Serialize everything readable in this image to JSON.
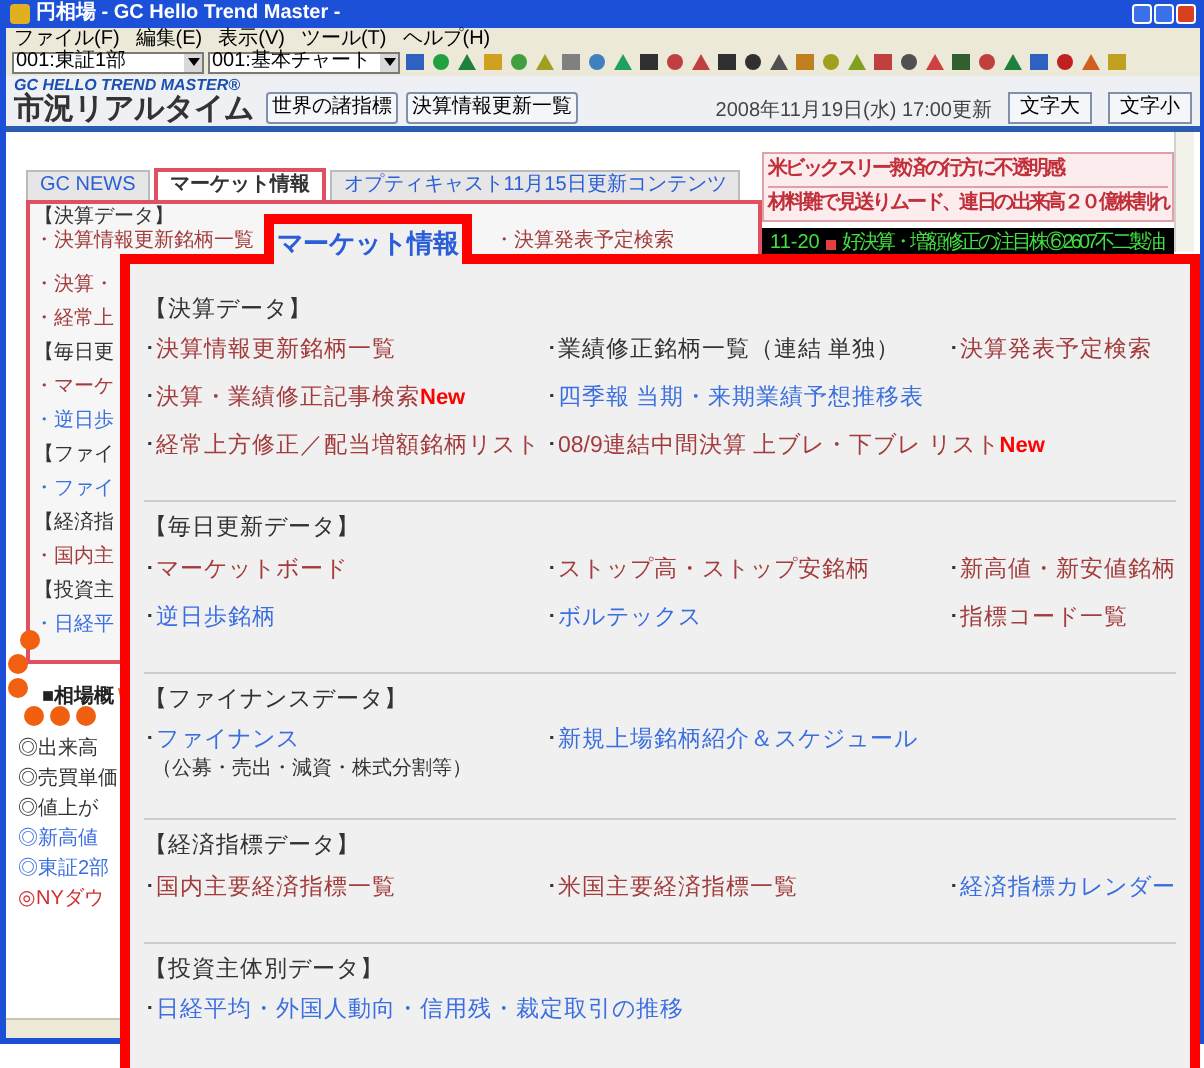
{
  "window": {
    "title": "円相場 - GC Hello Trend Master -"
  },
  "menu": [
    "ファイル(F)",
    "編集(E)",
    "表示(V)",
    "ツール(T)",
    "ヘルプ(H)"
  ],
  "toolbar": {
    "market_select": "001:東証1部",
    "chart_select": "001:基本チャート"
  },
  "header": {
    "brand": "GC HELLO TREND MASTER®",
    "title": "市況リアルタイム",
    "links": [
      "世界の諸指標",
      "決算情報更新一覧"
    ],
    "updated": "2008年11月19日(水) 17:00更新",
    "font_buttons": [
      "文字大",
      "文字小"
    ]
  },
  "tabs": [
    {
      "label": "GC NEWS",
      "selected": false
    },
    {
      "label": "マーケット情報",
      "selected": true
    },
    {
      "label": "オプティキャスト11月15日更新コンテンツ",
      "selected": false
    }
  ],
  "market_panel": {
    "heading": "【決算データ】",
    "top_links": [
      {
        "text": "・決算情報更新銘柄一覧",
        "color": "#a33c3c"
      },
      {
        "text": "・決算発表予定検索",
        "color": "#a33c3c"
      }
    ],
    "side_items": [
      {
        "text": "・決算・",
        "color": "#a33c3c"
      },
      {
        "text": "・経常上",
        "color": "#a33c3c"
      },
      {
        "text": "【毎日更",
        "color": "#333333"
      },
      {
        "text": "・マーケ",
        "color": "#a33c3c"
      },
      {
        "text": "・逆日歩",
        "color": "#3b6fe0"
      },
      {
        "text": "【ファイ",
        "color": "#333333"
      },
      {
        "text": "・ファイ",
        "color": "#3b6fe0"
      },
      {
        "text": "【経済指",
        "color": "#333333"
      },
      {
        "text": "・国内主",
        "color": "#a33c3c"
      },
      {
        "text": "【投資主",
        "color": "#333333"
      },
      {
        "text": "・日経平",
        "color": "#3b6fe0"
      }
    ]
  },
  "market_overview": {
    "title": "■相場概",
    "items": [
      {
        "text": "◎出来高",
        "color": "#333333"
      },
      {
        "text": "◎売買単価",
        "color": "#333333"
      },
      {
        "text": "◎値上が",
        "color": "#333333"
      },
      {
        "text": "◎新高値",
        "color": "#3b6fe0"
      },
      {
        "text": "◎東証2部",
        "color": "#3b6fe0"
      },
      {
        "text": "◎NYダウ",
        "color": "#d03030"
      }
    ]
  },
  "headlines": [
    "米ビックスリー救済の行方に不透明感",
    "材料難で見送りムード、連日の出来高２０億株割れ"
  ],
  "ticker": [
    {
      "date": "11-20",
      "text": "好決算・増額修正の注目株⑥2607不二製油"
    }
  ],
  "callout": {
    "tab": "マーケット情報",
    "sections": [
      {
        "heading": "【決算データ】",
        "rows": [
          [
            {
              "bullet": "･",
              "text": "決算情報更新銘柄一覧",
              "color": "#a33c3c"
            },
            {
              "bullet": "･",
              "text": "業績修正銘柄一覧（連結 単独）",
              "color": "#333333"
            },
            {
              "bullet": "･",
              "text": "決算発表予定検索",
              "color": "#a33c3c"
            }
          ],
          [
            {
              "bullet": "･",
              "text": "決算・業績修正記事検索",
              "color": "#a33c3c",
              "badge": "New"
            },
            {
              "bullet": "･",
              "text": "四季報 当期・来期業績予想推移表",
              "color": "#3b6fe0"
            }
          ],
          [
            {
              "bullet": "･",
              "text": "経常上方修正／配当増額銘柄リスト",
              "color": "#a33c3c"
            },
            {
              "bullet": "･",
              "text": "08/9連結中間決算 上ブレ・下ブレ リスト",
              "color": "#a33c3c",
              "badge": "New"
            }
          ]
        ]
      },
      {
        "heading": "【毎日更新データ】",
        "rows": [
          [
            {
              "bullet": "･",
              "text": "マーケットボード",
              "color": "#a33c3c"
            },
            {
              "bullet": "･",
              "text": "ストップ高・ストップ安銘柄",
              "color": "#a33c3c"
            },
            {
              "bullet": "･",
              "text": "新高値・新安値銘柄",
              "color": "#a33c3c"
            }
          ],
          [
            {
              "bullet": "･",
              "text": "逆日歩銘柄",
              "color": "#3b6fe0"
            },
            {
              "bullet": "･",
              "text": "ボルテックス",
              "color": "#3b6fe0"
            },
            {
              "bullet": "･",
              "text": "指標コード一覧",
              "color": "#a33c3c"
            }
          ]
        ]
      },
      {
        "heading": "【ファイナンスデータ】",
        "rows": [
          [
            {
              "bullet": "･",
              "text": "ファイナンス",
              "color": "#3b6fe0",
              "note": "（公募・売出・減資・株式分割等）"
            },
            {
              "bullet": "･",
              "text": "新規上場銘柄紹介＆スケジュール",
              "color": "#3b6fe0"
            }
          ]
        ]
      },
      {
        "heading": "【経済指標データ】",
        "rows": [
          [
            {
              "bullet": "･",
              "text": "国内主要経済指標一覧",
              "color": "#a33c3c"
            },
            {
              "bullet": "･",
              "text": "米国主要経済指標一覧",
              "color": "#a33c3c"
            },
            {
              "bullet": "･",
              "text": "経済指標カレンダー",
              "color": "#3b6fe0"
            }
          ]
        ]
      },
      {
        "heading": "【投資主体別データ】",
        "rows": [
          [
            {
              "bullet": "･",
              "text": "日経平均・外国人動向・信用残・裁定取引の推移",
              "color": "#3b6fe0"
            }
          ]
        ]
      }
    ]
  }
}
